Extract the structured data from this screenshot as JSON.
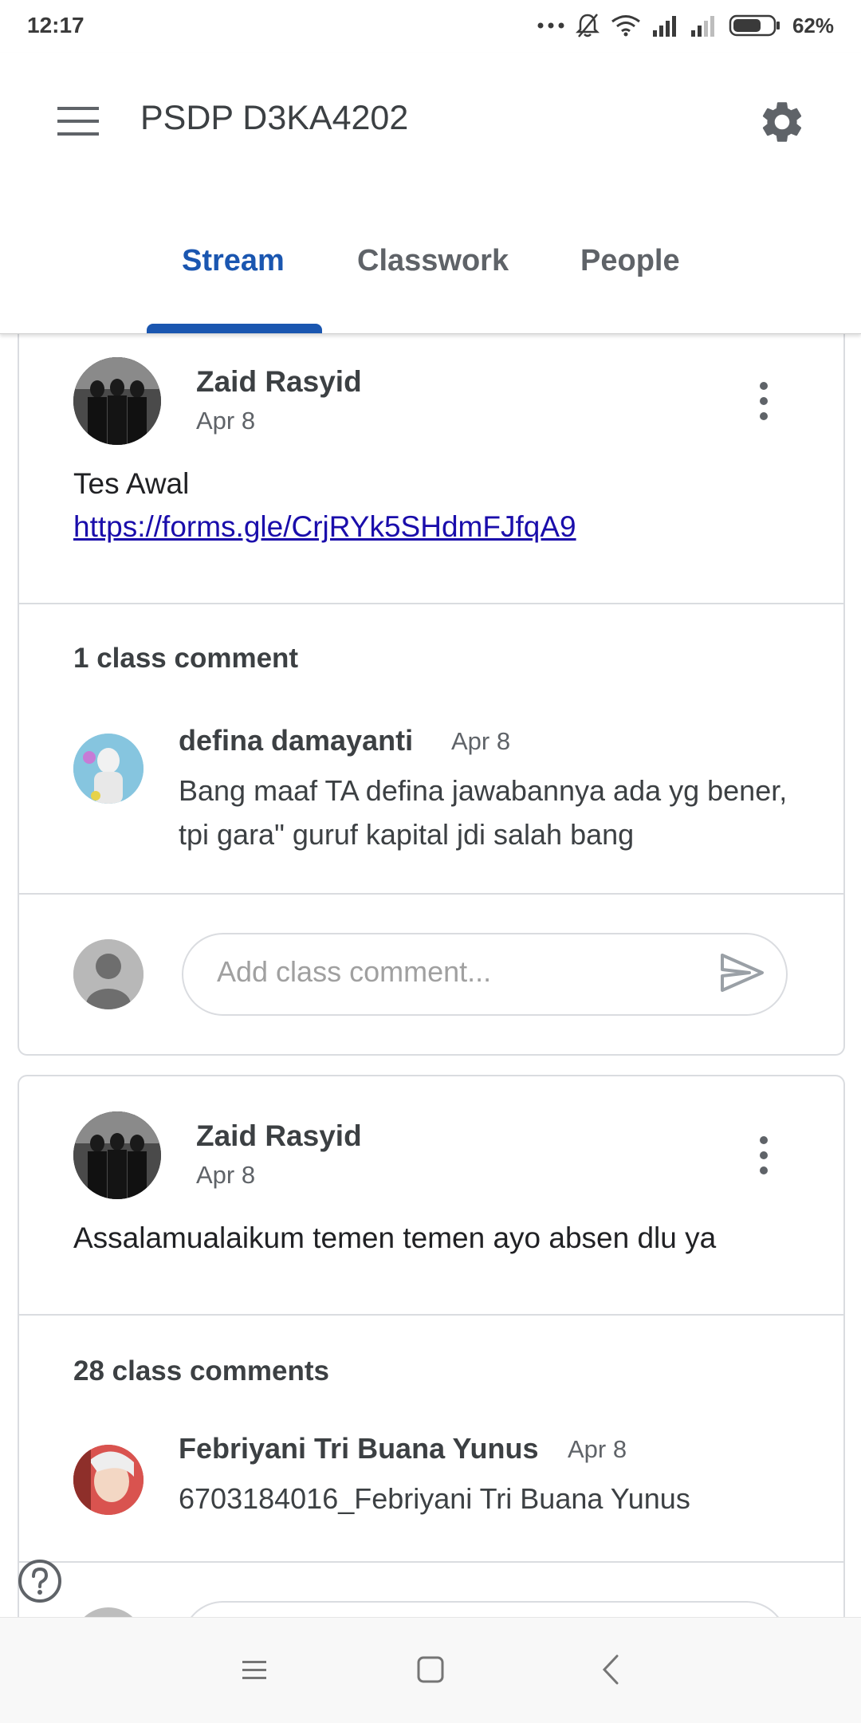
{
  "status_bar": {
    "time": "12:17",
    "battery": "62%",
    "icons": [
      "more-dots-icon",
      "bell-muted-icon",
      "wifi-icon",
      "signal-icon",
      "signal-weak-icon",
      "battery-icon"
    ]
  },
  "app_bar": {
    "title": "PSDP D3KA4202",
    "menu_icon": "menu-icon",
    "settings_icon": "gear-icon"
  },
  "tabs": [
    {
      "label": "Stream",
      "active": true
    },
    {
      "label": "Classwork",
      "active": false
    },
    {
      "label": "People",
      "active": false
    }
  ],
  "posts": [
    {
      "author": "Zaid Rasyid",
      "date": "Apr 8",
      "text": "Tes Awal",
      "link": "https://forms.gle/CrjRYk5SHdmFJfqA9",
      "comments_count": "1 class comment",
      "comment": {
        "author": "defina damayanti",
        "date": "Apr 8",
        "text": "Bang maaf TA defina jawabannya ada yg bener, tpi gara\" guruf kapital jdi salah bang"
      },
      "input_placeholder": "Add class comment..."
    },
    {
      "author": "Zaid Rasyid",
      "date": "Apr 8",
      "text": "Assalamualaikum temen temen ayo absen dlu ya",
      "comments_count": "28 class comments",
      "comment": {
        "author": "Febriyani Tri Buana Yunus",
        "date": "Apr 8",
        "text": "6703184016_Febriyani Tri Buana Yunus"
      }
    }
  ],
  "colors": {
    "accent": "#1a56b0",
    "link": "#1a0dab",
    "text": "#3c4043",
    "divider": "#dadce0"
  }
}
